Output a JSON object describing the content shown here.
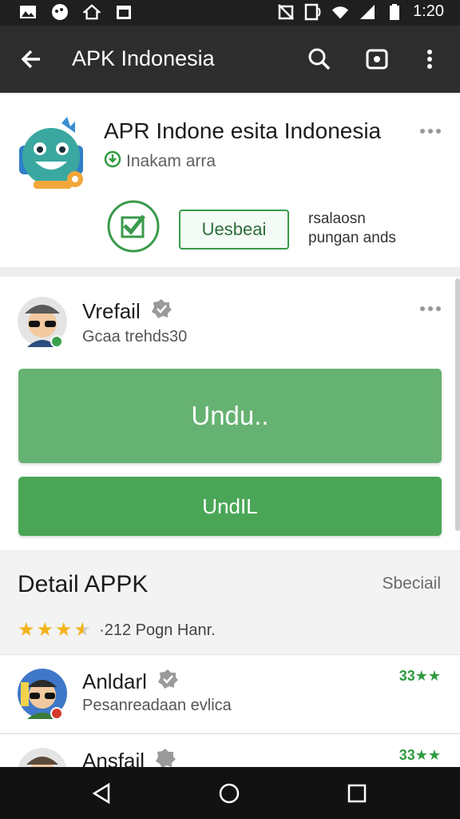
{
  "status_bar": {
    "time": "1:20",
    "left_icons": [
      "gallery-icon",
      "message-icon",
      "home-notification-icon",
      "calendar-icon"
    ],
    "right_icons": [
      "mute-icon",
      "nfc-icon",
      "wifi-icon",
      "signal-icon",
      "battery-icon"
    ]
  },
  "app_bar": {
    "title": "APK Indonesia",
    "icons": [
      "back-arrow-icon",
      "search-icon",
      "screenshot-icon",
      "more-vert-icon"
    ]
  },
  "app_card": {
    "title": "APR Indone esita Indonesia",
    "subtitle": "Inakam arra",
    "button_label": "Uesbeai",
    "side_text_line1": "rsalaosn",
    "side_text_line2": "pungan ands"
  },
  "user_card": {
    "name": "Vrefail",
    "subtitle": "Gcaa trehds30",
    "primary_button": "Undu..",
    "secondary_button": "UndIL"
  },
  "detail": {
    "title": "Detail APPK",
    "link": "Sbeciail",
    "rating_stars": 3.5,
    "rating_text": "·212 Pogn Hanr."
  },
  "list": [
    {
      "name": "Anldarl",
      "subtitle": "Pesanreadaan evlica",
      "rating": "33★★"
    },
    {
      "name": "Ansfail",
      "subtitle": "",
      "rating": "33★★"
    }
  ],
  "colors": {
    "primary_green": "#4aa656",
    "light_green": "#66b272",
    "star": "#f2b31b",
    "app_bar": "#2d2d2d"
  }
}
